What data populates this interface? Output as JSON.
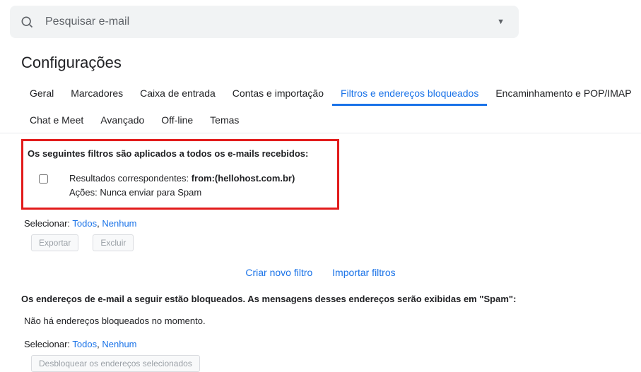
{
  "search": {
    "placeholder": "Pesquisar e-mail"
  },
  "title": "Configurações",
  "tabs": {
    "row1": [
      "Geral",
      "Marcadores",
      "Caixa de entrada",
      "Contas e importação",
      "Filtros e endereços bloqueados",
      "Encaminhamento e POP/IMAP"
    ],
    "row2": [
      "Chat e Meet",
      "Avançado",
      "Off-line",
      "Temas"
    ],
    "active": "Filtros e endereços bloqueados"
  },
  "filters": {
    "header": "Os seguintes filtros são aplicados a todos os e-mails recebidos:",
    "item": {
      "match_label": "Resultados correspondentes: ",
      "match_value": "from:(hellohost.com.br)",
      "actions": "Ações: Nunca enviar para Spam"
    },
    "select_label": "Selecionar: ",
    "select_all": "Todos",
    "select_sep": ", ",
    "select_none": "Nenhum",
    "export_btn": "Exportar",
    "delete_btn": "Excluir",
    "create_link": "Criar novo filtro",
    "import_link": "Importar filtros"
  },
  "blocked": {
    "header": "Os endereços de e-mail a seguir estão bloqueados. As mensagens desses endereços serão exibidas em \"Spam\":",
    "empty": "Não há endereços bloqueados no momento.",
    "select_label": "Selecionar: ",
    "select_all": "Todos",
    "select_sep": ", ",
    "select_none": "Nenhum",
    "unblock_btn": "Desbloquear os endereços selecionados"
  }
}
